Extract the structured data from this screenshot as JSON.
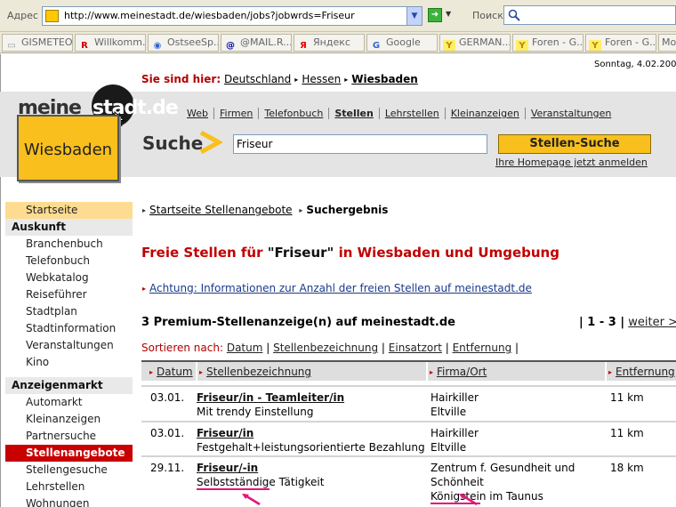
{
  "browser": {
    "address_label": "Адрес",
    "url": "http://www.meinestadt.de/wiesbaden/jobs?jobwrds=Friseur",
    "search_label": "Поиск",
    "bookmarks": [
      "GISMETEO.R...",
      "Willkomm...",
      "OstseeSp...",
      "@MAIL.R...",
      "Яндекс",
      "Google",
      "GERMAN...",
      "Foren - G...",
      "Foren - G...",
      "Mo"
    ]
  },
  "page": {
    "date": "Sonntag, 4.02.200",
    "location": {
      "label": "Sie sind hier:",
      "items": [
        "Deutschland",
        "Hessen",
        "Wiesbaden"
      ]
    },
    "logo": {
      "text_left": "meine",
      "text_ball": "stadt.de",
      "city": "Wiesbaden"
    },
    "topnav": [
      "Web",
      "Firmen",
      "Telefonbuch",
      "Stellen",
      "Lehrstellen",
      "Kleinanzeigen",
      "Veranstaltungen"
    ],
    "search": {
      "label": "Suche",
      "value": "Friseur",
      "button": "Stellen-Suche",
      "homepage_link": "Ihre Homepage jetzt anmelden"
    },
    "sidebar": {
      "home": "Startseite",
      "section1": "Auskunft",
      "items1": [
        "Branchenbuch",
        "Telefonbuch",
        "Webkatalog",
        "Reiseführer",
        "Stadtplan",
        "Stadtinformation",
        "Veranstaltungen",
        "Kino"
      ],
      "section2": "Anzeigenmarkt",
      "items2": [
        "Automarkt",
        "Kleinanzeigen",
        "Partnersuche",
        "Stellenangebote",
        "Stellengesuche",
        "Lehrstellen",
        "Wohnungen"
      ]
    },
    "main": {
      "crumb_link": "Startseite Stellenangebote",
      "crumb_current": "Suchergebnis",
      "title_pre": "Freie Stellen für ",
      "title_query": "\"Friseur\"",
      "title_post": " in Wiesbaden und Umgebung",
      "notice": "Achtung: Informationen zur Anzahl der freien Stellen auf meinestadt.de",
      "count": "3 Premium-Stellenanzeige(n) auf meinestadt.de",
      "pager_range": "| 1 - 3 |",
      "pager_next": "weiter >",
      "sort_label": "Sortieren nach:",
      "sort_options": [
        "Datum",
        "Stellenbezeichnung",
        "Einsatzort",
        "Entfernung"
      ],
      "columns": [
        "Datum",
        "Stellenbezeichnung",
        "Firma/Ort",
        "Entfernung"
      ],
      "rows": [
        {
          "date": "03.01.",
          "title": "Friseur/in - Teamleiter/in",
          "desc": "Mit trendy Einstellung",
          "company": "Hairkiller",
          "place": "Eltville",
          "place2": "",
          "distance": "11 km"
        },
        {
          "date": "03.01.",
          "title": "Friseur/in",
          "desc": "Festgehalt+leistungsorientierte Bezahlung",
          "company": "Hairkiller",
          "place": "Eltville",
          "place2": "",
          "distance": "11 km"
        },
        {
          "date": "29.11.",
          "title": "Friseur/-in",
          "desc": "Selbstständige Tätigkeit",
          "company": "Zentrum f. Gesundheit und",
          "place": "Schönheit",
          "place2": "Königstein im Taunus",
          "distance": "18 km"
        }
      ]
    }
  }
}
